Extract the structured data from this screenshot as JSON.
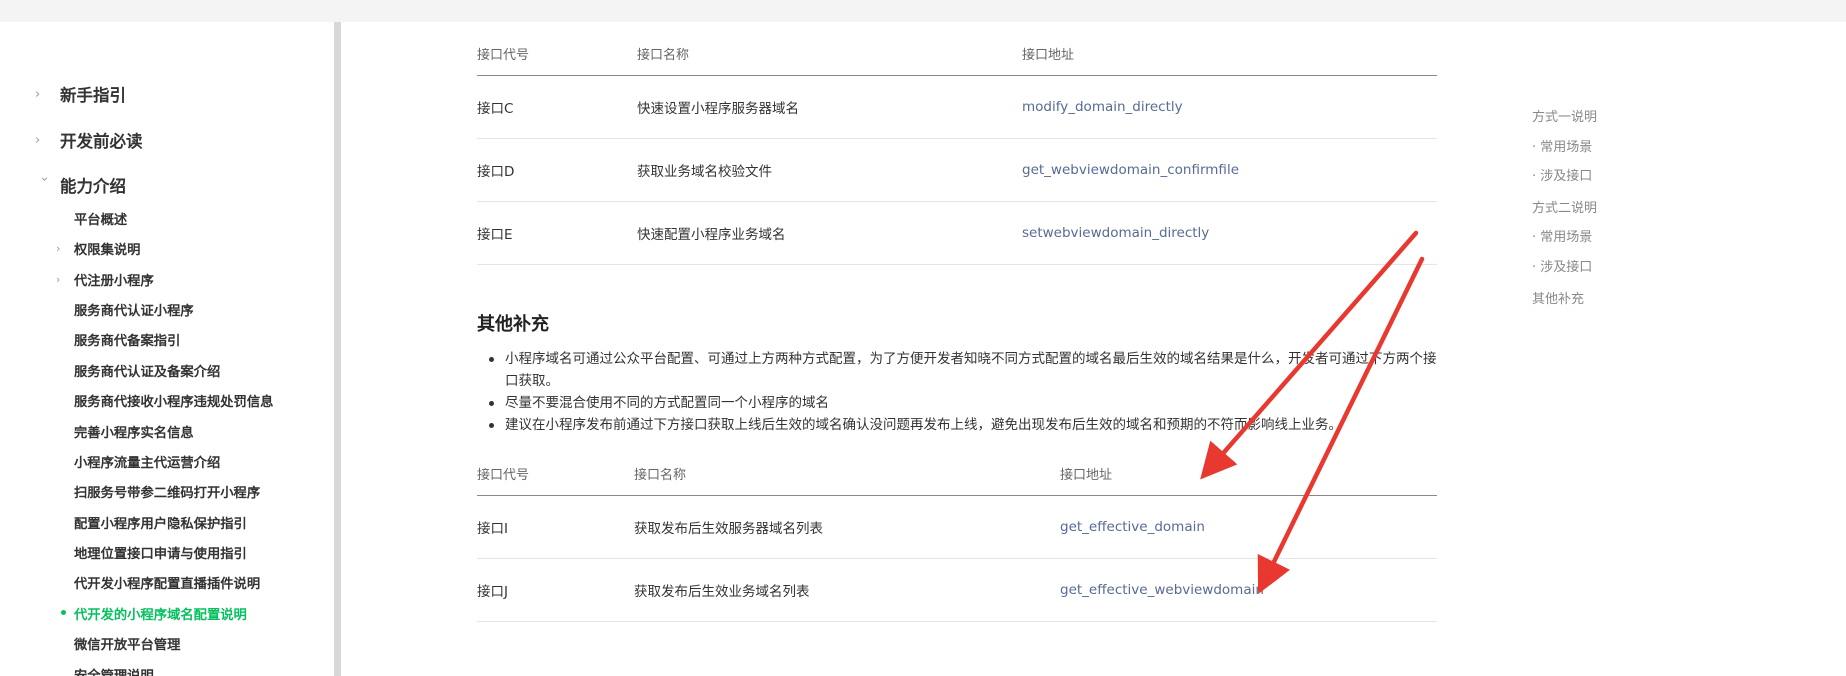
{
  "sidebar": {
    "top": [
      {
        "label": "新手指引",
        "expanded": false
      },
      {
        "label": "开发前必读",
        "expanded": false
      },
      {
        "label": "能力介绍",
        "expanded": true
      }
    ],
    "sub": [
      {
        "label": "平台概述",
        "has_children": false,
        "active": false
      },
      {
        "label": "权限集说明",
        "has_children": true,
        "active": false
      },
      {
        "label": "代注册小程序",
        "has_children": true,
        "active": false
      },
      {
        "label": "服务商代认证小程序",
        "has_children": false,
        "active": false
      },
      {
        "label": "服务商代备案指引",
        "has_children": false,
        "active": false
      },
      {
        "label": "服务商代认证及备案介绍",
        "has_children": false,
        "active": false
      },
      {
        "label": "服务商代接收小程序违规处罚信息",
        "has_children": false,
        "active": false
      },
      {
        "label": "完善小程序实名信息",
        "has_children": false,
        "active": false
      },
      {
        "label": "小程序流量主代运营介绍",
        "has_children": false,
        "active": false
      },
      {
        "label": "扫服务号带参二维码打开小程序",
        "has_children": false,
        "active": false
      },
      {
        "label": "配置小程序用户隐私保护指引",
        "has_children": false,
        "active": false
      },
      {
        "label": "地理位置接口申请与使用指引",
        "has_children": false,
        "active": false
      },
      {
        "label": "代开发小程序配置直播插件说明",
        "has_children": false,
        "active": false
      },
      {
        "label": "代开发的小程序域名配置说明",
        "has_children": false,
        "active": true
      },
      {
        "label": "微信开放平台管理",
        "has_children": false,
        "active": false
      },
      {
        "label": "安全管理说明",
        "has_children": false,
        "active": false
      }
    ]
  },
  "table1": {
    "headers": [
      "接口代号",
      "接口名称",
      "接口地址"
    ],
    "rows": [
      [
        "接口C",
        "快速设置小程序服务器域名",
        "modify_domain_directly"
      ],
      [
        "接口D",
        "获取业务域名校验文件",
        "get_webviewdomain_confirmfile"
      ],
      [
        "接口E",
        "快速配置小程序业务域名",
        "setwebviewdomain_directly"
      ]
    ]
  },
  "section": {
    "title": "其他补充",
    "bullets": [
      "小程序域名可通过公众平台配置、可通过上方两种方式配置，为了方便开发者知晓不同方式配置的域名最后生效的域名结果是什么，开发者可通过下方两个接口获取。",
      "尽量不要混合使用不同的方式配置同一个小程序的域名",
      "建议在小程序发布前通过下方接口获取上线后生效的域名确认没问题再发布上线，避免出现发布后生效的域名和预期的不符而影响线上业务。"
    ]
  },
  "table2": {
    "headers": [
      "接口代号",
      "接口名称",
      "接口地址"
    ],
    "rows": [
      [
        "接口I",
        "获取发布后生效服务器域名列表",
        "get_effective_domain"
      ],
      [
        "接口J",
        "获取发布后生效业务域名列表",
        "get_effective_webviewdomain"
      ]
    ]
  },
  "toc": [
    "方式一说明",
    "· 常用场景",
    "· 涉及接口",
    "方式二说明",
    "· 常用场景",
    "· 涉及接口",
    "其他补充"
  ],
  "colors": {
    "accent_green": "#07c160",
    "link": "#576b95",
    "annotation_red": "#e8382f"
  }
}
